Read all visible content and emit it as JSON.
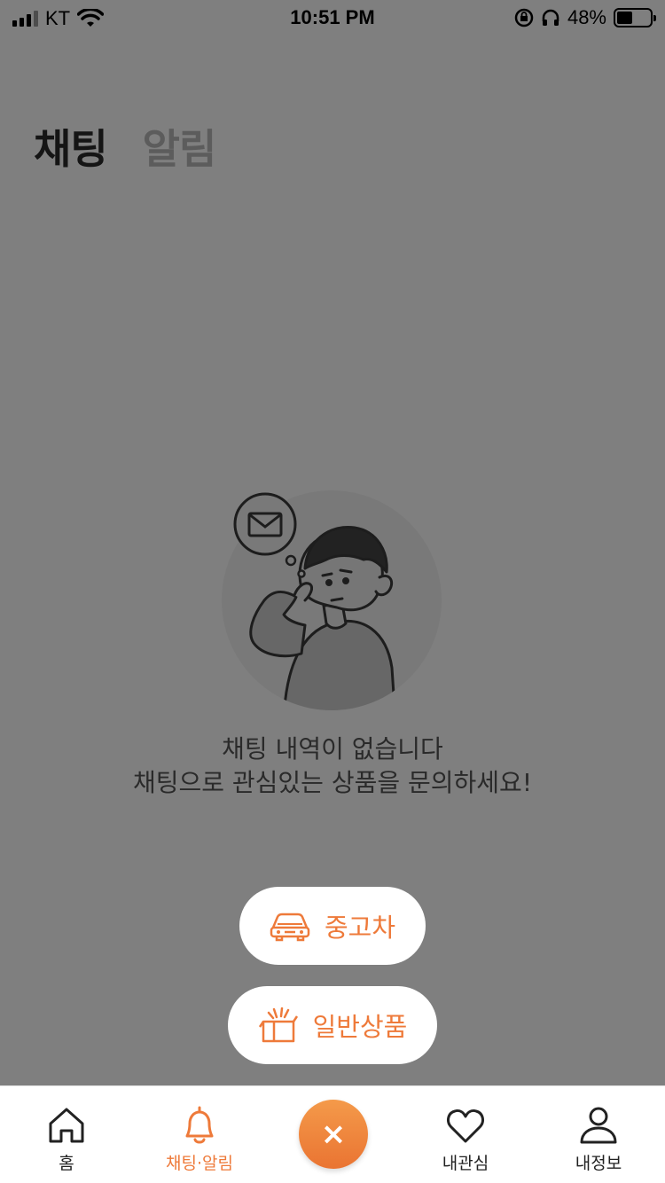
{
  "status_bar": {
    "carrier": "KT",
    "time": "10:51 PM",
    "battery": "48%"
  },
  "page_tabs": [
    {
      "label": "채팅",
      "active": true
    },
    {
      "label": "알림",
      "active": false
    }
  ],
  "empty_state": {
    "line1": "채팅 내역이 없습니다",
    "line2": "채팅으로 관심있는 상품을 문의하세요!"
  },
  "fab_menu": {
    "used_car_label": "중고차",
    "general_label": "일반상품",
    "close_symbol": "×"
  },
  "tab_bar": {
    "home": "홈",
    "chat": "채팅·알림",
    "like": "내관심",
    "my": "내정보"
  },
  "colors": {
    "accent": "#ee7a3a",
    "overlay": "rgba(0,0,0,0.5)"
  }
}
